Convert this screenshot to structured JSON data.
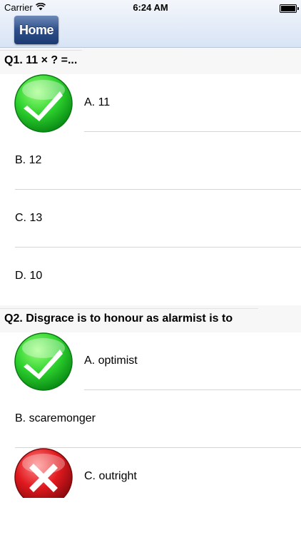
{
  "status": {
    "carrier": "Carrier",
    "time": "6:24 AM"
  },
  "nav": {
    "home_label": "Home"
  },
  "questions": [
    {
      "title": "Q1. 11 × ? =...",
      "options": [
        {
          "label": "A. 11",
          "mark": "correct"
        },
        {
          "label": "B. 12",
          "mark": "none"
        },
        {
          "label": "C. 13",
          "mark": "none"
        },
        {
          "label": "D. 10",
          "mark": "none"
        }
      ]
    },
    {
      "title": "Q2. Disgrace is to honour as alarmist is to",
      "options": [
        {
          "label": "A. optimist",
          "mark": "correct"
        },
        {
          "label": "B. scaremonger",
          "mark": "none"
        },
        {
          "label": "C. outright",
          "mark": "wrong"
        }
      ]
    }
  ],
  "colors": {
    "correct": "#2fd32f",
    "wrong": "#e0191e",
    "nav_button": "#1b3a73"
  },
  "icons": {
    "correct": "checkmark-icon",
    "wrong": "cross-icon"
  }
}
